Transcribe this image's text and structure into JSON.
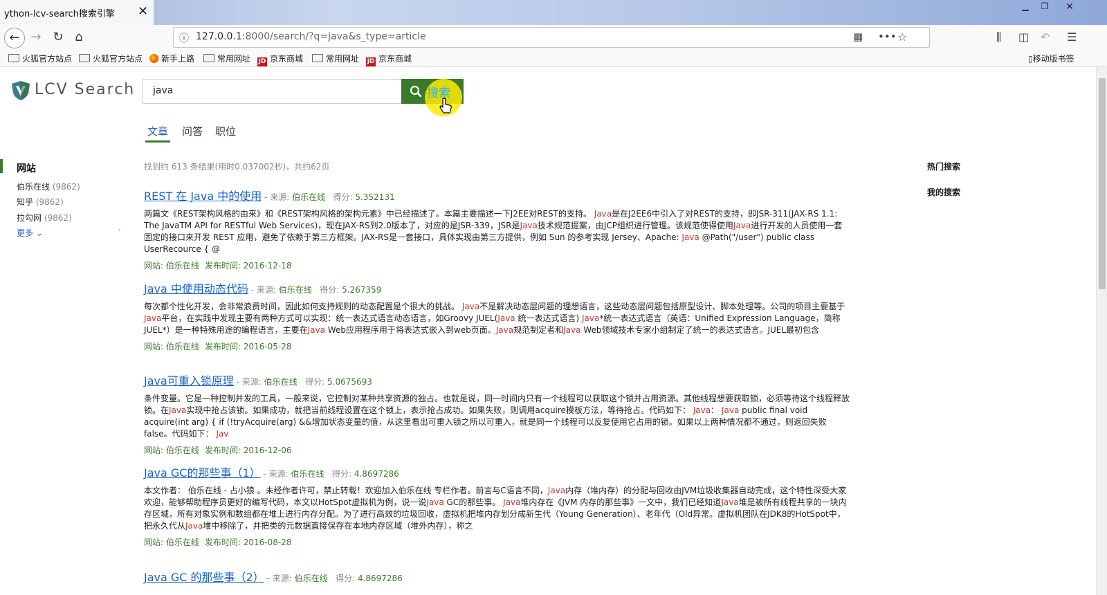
{
  "browser": {
    "tab_title": "ython-lcv-search搜索引擎",
    "tab_close": "✕",
    "url_host": "127.0.0.1",
    "url_rest": ":8000/search/?q=java&s_type=article",
    "bookmarks": [
      {
        "label": "火狐官方站点",
        "icon": "folder-icon"
      },
      {
        "label": "火狐官方站点",
        "icon": "folder-icon"
      },
      {
        "label": "新手上路",
        "icon": "firefox-icon"
      },
      {
        "label": "常用网址",
        "icon": "folder-icon"
      },
      {
        "label": "京东商城",
        "icon": "jd-icon"
      },
      {
        "label": "常用网址",
        "icon": "folder-icon"
      },
      {
        "label": "京东商城",
        "icon": "jd-icon"
      }
    ],
    "mobile_bookmarks": "移动版书签"
  },
  "header": {
    "logo_text": "LCV Search",
    "search_value": "java",
    "search_button": "搜索"
  },
  "nav_tabs": [
    {
      "label": "文章",
      "active": true
    },
    {
      "label": "问答",
      "active": false
    },
    {
      "label": "职位",
      "active": false
    }
  ],
  "summary": "找到约 613 条结果(用时0.037002秒)，共约62页",
  "sidebar": {
    "title": "网站",
    "items": [
      {
        "name": "伯乐在线",
        "count": "(9862)"
      },
      {
        "name": "知乎",
        "count": "(9862)"
      },
      {
        "name": "拉勾网",
        "count": "(9862)"
      }
    ],
    "more": "更多 ⌄",
    "collapse": "‹"
  },
  "right": {
    "hot": "热门搜索",
    "mine": "我的搜索"
  },
  "labels": {
    "source": "- 来源:",
    "score": "得分:",
    "site": "网站:",
    "published": "发布时间:"
  },
  "results": [
    {
      "title": "REST 在 Java 中的使用",
      "source": "伯乐在线",
      "score": "5.352131",
      "site": "伯乐在线",
      "date": "2016-12-18",
      "body": [
        [
          "t",
          "两篇文《REST架构风格的由来》和《REST架构风格的架构元素》中已经描述了。本篇主要描述一下J2EE对REST的支持。 "
        ],
        [
          "h",
          "Java"
        ],
        [
          "t",
          "是在J2EE6中引入了对REST的支持，即JSR-311(JAX-RS 1.1: The JavaTM API for RESTful Web Services)，现在JAX-RS到2.0版本了，对应的是JSR-339，JSR是"
        ],
        [
          "h",
          "Java"
        ],
        [
          "t",
          "技术规范提案，由JCP组织进行管理。该规范使得使用"
        ],
        [
          "h",
          "Java"
        ],
        [
          "t",
          "进行开发的人员使用一套固定的接口来开发 REST 应用，避免了依赖于第三方框架。JAX-RS是一套接口，具体实现由第三方提供，例如 Sun 的参考实现 Jersey、Apache: "
        ],
        [
          "h",
          "Java"
        ],
        [
          "t",
          " @Path(\"/user\") public class UserRecource { @"
        ]
      ]
    },
    {
      "title": "Java 中使用动态代码",
      "source": "伯乐在线",
      "score": "5.267359",
      "site": "伯乐在线",
      "date": "2016-05-28",
      "body": [
        [
          "t",
          "每次都个性化开发，会非常浪费时间，因此如何支持规则的动态配置是个很大的挑战。 "
        ],
        [
          "h",
          "Java"
        ],
        [
          "t",
          "不是解决动态层问题的理想语言，这些动态层问题包括原型设计、脚本处理等。公司的项目主要基于"
        ],
        [
          "h",
          "Java"
        ],
        [
          "t",
          "平台，在实践中发现主要有两种方式可以实现：统一表达式语言动态语言，如Groovy JUEL("
        ],
        [
          "h",
          "Java"
        ],
        [
          "t",
          " 统一表达式语言) "
        ],
        [
          "h",
          "Java"
        ],
        [
          "t",
          "*统一表达式语言（英语：Unified Expression Language，简称JUEL*）是一种特殊用途的编程语言，主要在"
        ],
        [
          "h",
          "Java"
        ],
        [
          "t",
          " Web应用程序用于将表达式嵌入到web页面。"
        ],
        [
          "h",
          "Java"
        ],
        [
          "t",
          "规范制定者和"
        ],
        [
          "h",
          "Java"
        ],
        [
          "t",
          " Web领域技术专家小组制定了统一的表达式语言。JUEL最初包含"
        ]
      ]
    },
    {
      "title": "Java可重入锁原理",
      "source": "伯乐在线",
      "score": "5.0675693",
      "site": "伯乐在线",
      "date": "2016-12-06",
      "body": [
        [
          "t",
          "条件变量。它是一种控制并发的工具，一般来说，它控制对某种共享资源的独占。也就是说，同一时间内只有一个线程可以获取这个锁并占用资源。其他线程想要获取锁，必须等待这个线程释放锁。在"
        ],
        [
          "h",
          "Java"
        ],
        [
          "t",
          "实现中抢占该锁。如果成功，就把当前线程设置在这个锁上，表示抢占成功。如果失败，则调用acquire模板方法，等待抢占。代码如下： "
        ],
        [
          "h",
          "Java"
        ],
        [
          "t",
          "： "
        ],
        [
          "h",
          "Java"
        ],
        [
          "t",
          " public final void acquire(int arg) { if (!tryAcquire(arg) &&增加状态变量的值，从这里看出可重入锁之所以可重入，就是同一个线程可以反复使用它占用的锁。如果以上两种情况都不通过，则返回失败false。代码如下： "
        ],
        [
          "h",
          "Jav"
        ]
      ]
    },
    {
      "title": "Java GC的那些事（1）",
      "source": "伯乐在线",
      "score": "4.8697286",
      "site": "伯乐在线",
      "date": "2016-08-28",
      "body": [
        [
          "t",
          "本文作者： 伯乐在线 - 占小狼 。未经作者许可，禁止转载！欢迎加入伯乐在线 专栏作者。前言与C语言不同，"
        ],
        [
          "h",
          "Java"
        ],
        [
          "t",
          "内存（堆内存）的分配与回收由JVM垃圾收集器自动完成，这个特性深受大家欢迎，能够帮助程序员更好的编写代码，本文以HotSpot虚拟机为例，说一说"
        ],
        [
          "h",
          "Java"
        ],
        [
          "t",
          " GC的那些事。 "
        ],
        [
          "h",
          "Java"
        ],
        [
          "t",
          "堆内存在《JVM 内存的那些事》一文中，我们已经知道"
        ],
        [
          "h",
          "Java"
        ],
        [
          "t",
          "堆是被所有线程共享的一块内存区域，所有对象实例和数组都在堆上进行内存分配。为了进行高效的垃圾回收，虚拟机把堆内存划分成新生代（Young Generation）、老年代（Old异常。虚拟机团队在JDK8的HotSpot中，把永久代从"
        ],
        [
          "h",
          "Java"
        ],
        [
          "t",
          "堆中移除了，并把类的元数据直接保存在本地内存区域（堆外内存），称之"
        ]
      ]
    },
    {
      "title": "Java GC 的那些事（2）",
      "source": "伯乐在线",
      "score": "4.8697286",
      "site": "",
      "date": "",
      "body": []
    }
  ]
}
